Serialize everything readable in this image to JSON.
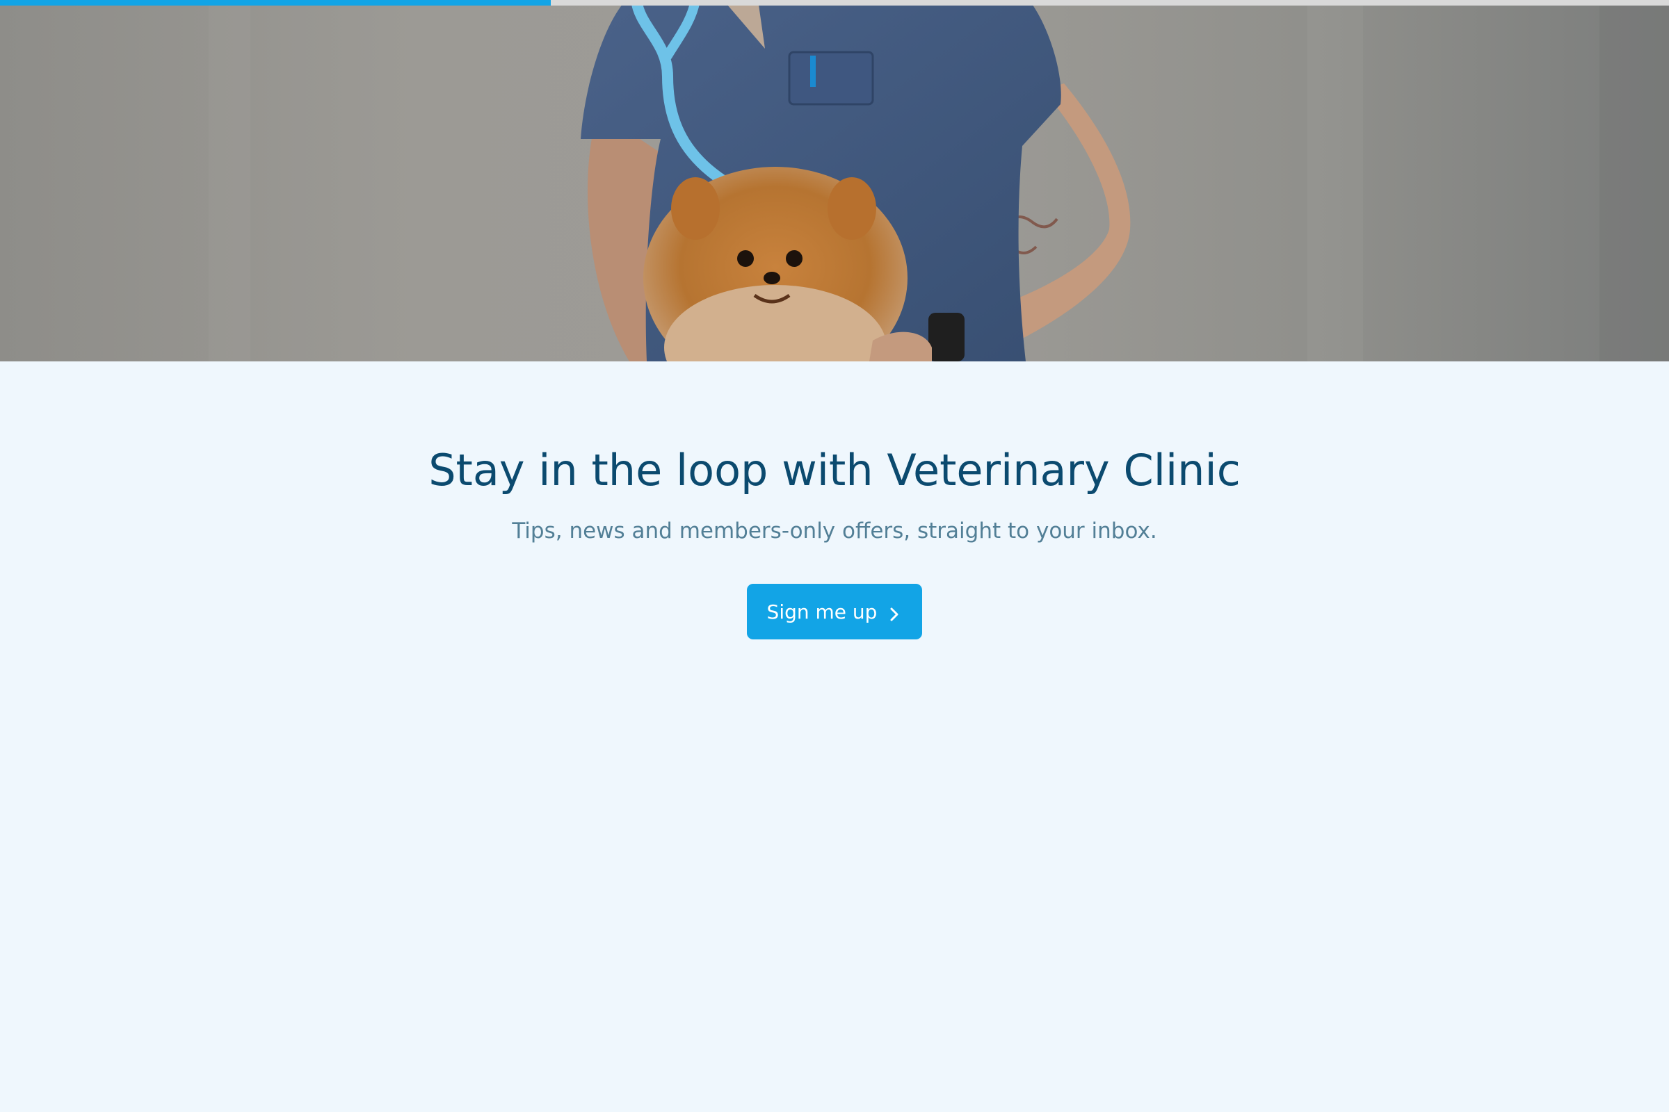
{
  "progress": {
    "value": 0.33,
    "color": "#12a4e6",
    "track_color": "#d9d9d9"
  },
  "hero": {
    "image": "veterinarian-holding-pomeranian-photo"
  },
  "newsletter": {
    "headline": "Stay in the loop with Veterinary Clinic",
    "subline": "Tips, news and members-only offers, straight to your inbox.",
    "cta_label": "Sign me up",
    "cta_icon": "chevron-right-icon"
  },
  "colors": {
    "background": "#eff7fd",
    "headline": "#0b4a6f",
    "subline": "#527f96",
    "accent": "#12a4e6"
  }
}
